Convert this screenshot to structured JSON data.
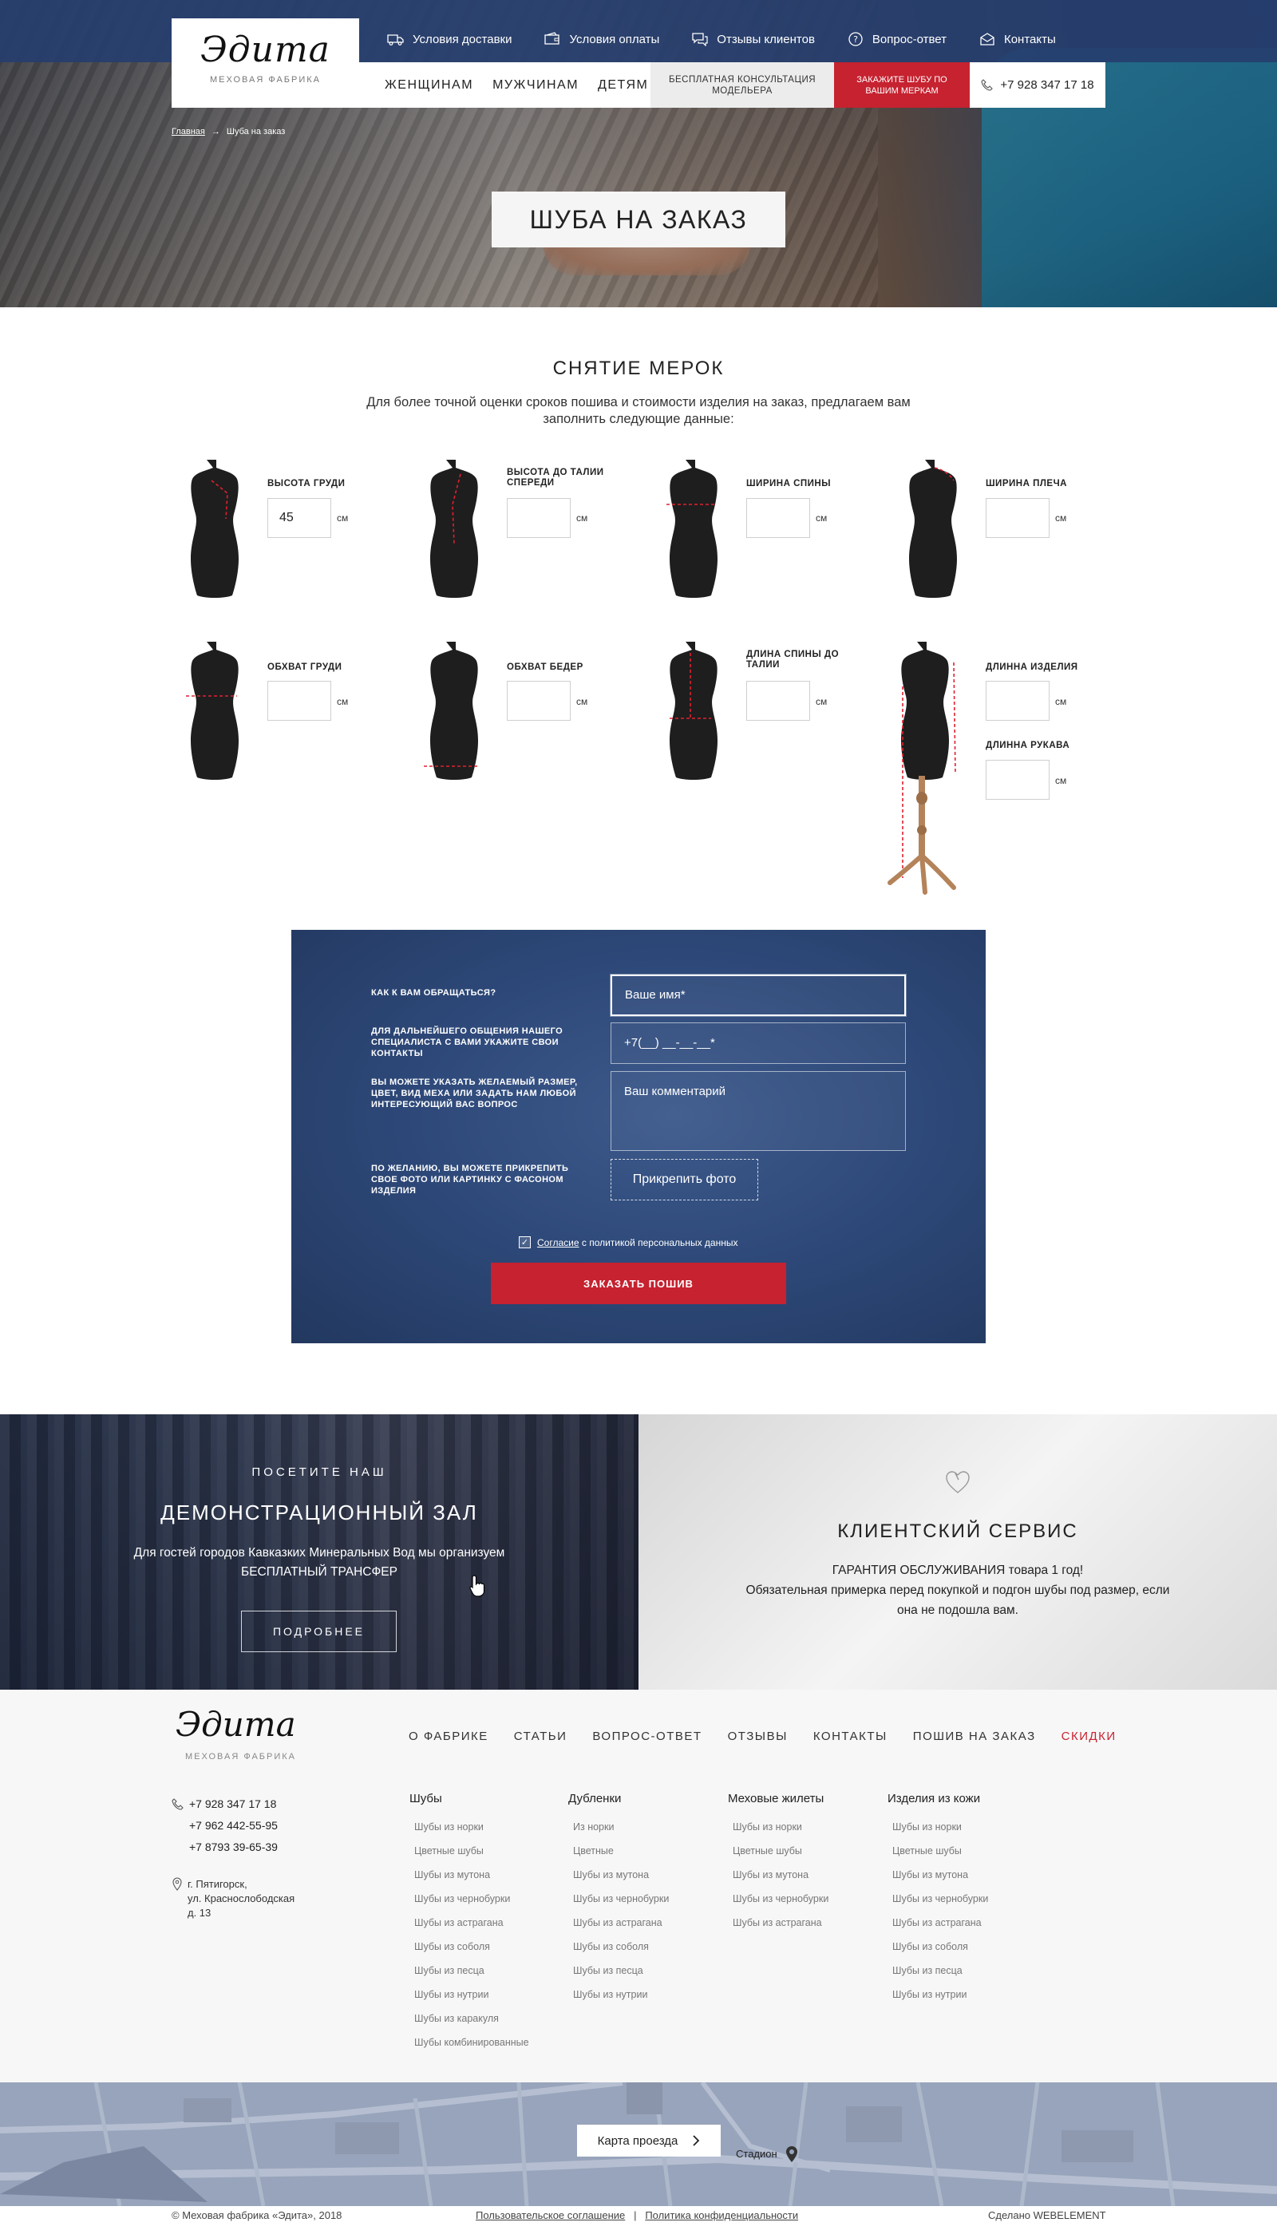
{
  "brand": {
    "name": "Эдита",
    "tagline": "МЕХОВАЯ ФАБРИКА"
  },
  "toplinks": [
    {
      "label": "Условия доставки",
      "icon": "truck-icon"
    },
    {
      "label": "Условия оплаты",
      "icon": "wallet-icon"
    },
    {
      "label": "Отзывы клиентов",
      "icon": "chat-icon"
    },
    {
      "label": "Вопрос-ответ",
      "icon": "question-icon"
    },
    {
      "label": "Контакты",
      "icon": "envelope-icon"
    }
  ],
  "nav": {
    "menu": [
      "ЖЕНЩИНАМ",
      "МУЖЧИНАМ",
      "ДЕТЯМ"
    ],
    "consult": "БЕСПЛАТНАЯ КОНСУЛЬТАЦИЯ МОДЕЛЬЕРА",
    "order": "ЗАКАЖИТЕ ШУБУ ПО ВАШИМ МЕРКАМ",
    "phone": "+7 928 347 17 18"
  },
  "breadcrumbs": {
    "home": "Главная",
    "sep": "→",
    "current": "Шуба на заказ"
  },
  "hero": {
    "title": "ШУБА НА ЗАКАЗ"
  },
  "measurements": {
    "title": "СНЯТИЕ МЕРОК",
    "description": "Для более точной оценки сроков пошива и стоимости изделия на заказ, предлагаем вам заполнить следующие данные:",
    "unit": "см",
    "items": [
      {
        "label": "ВЫСОТА ГРУДИ",
        "value": "45"
      },
      {
        "label": "ВЫСОТА ДО ТАЛИИ СПЕРЕДИ",
        "value": ""
      },
      {
        "label": "ШИРИНА СПИНЫ",
        "value": ""
      },
      {
        "label": "ШИРИНА ПЛЕЧА",
        "value": ""
      },
      {
        "label": "ОБХВАТ ГРУДИ",
        "value": ""
      },
      {
        "label": "ОБХВАТ БЕДЕР",
        "value": ""
      },
      {
        "label": "ДЛИНА СПИНЫ ДО ТАЛИИ",
        "value": ""
      },
      {
        "label": "ДЛИННА ИЗДЕЛИЯ",
        "value": ""
      },
      {
        "label": "ДЛИННА РУКАВА",
        "value": ""
      }
    ]
  },
  "form": {
    "name_label": "КАК К ВАМ ОБРАЩАТЬСЯ?",
    "name_placeholder": "Ваше имя*",
    "phone_label": "ДЛЯ ДАЛЬНЕЙШЕГО ОБЩЕНИЯ НАШЕГО СПЕЦИАЛИСТА С ВАМИ УКАЖИТЕ СВОИ КОНТАКТЫ",
    "phone_placeholder": "+7(__) __-__-__*",
    "comment_label": "ВЫ МОЖЕТЕ УКАЗАТЬ ЖЕЛАЕМЫЙ РАЗМЕР, ЦВЕТ, ВИД МЕХА ИЛИ ЗАДАТЬ НАМ ЛЮБОЙ ИНТЕРЕСУЮЩИЙ ВАС ВОПРОС",
    "comment_placeholder": "Ваш комментарий",
    "attach_label": "ПО ЖЕЛАНИЮ, ВЫ МОЖЕТЕ ПРИКРЕПИТЬ СВОЕ ФОТО ИЛИ КАРТИНКУ С ФАСОНОМ ИЗДЕЛИЯ",
    "attach_button": "Прикрепить фото",
    "consent_link": "Согласие",
    "consent_rest": "с политикой персональных данных",
    "submit": "ЗАКАЗАТЬ ПОШИВ"
  },
  "promo_left": {
    "kicker": "ПОСЕТИТЕ НАШ",
    "title": "ДЕМОНСТРАЦИОННЫЙ ЗАЛ",
    "desc1": "Для гостей городов Кавказких Минеральных Вод мы организуем",
    "desc2": "БЕСПЛАТНЫЙ ТРАНСФЕР",
    "button": "ПОДРОБНЕЕ"
  },
  "promo_right": {
    "title": "КЛИЕНТСКИЙ СЕРВИС",
    "line1a": "ГАРАНТИЯ ОБСЛУЖИВАНИЯ",
    "line1b": "товара  1 год!",
    "line2": "Обязательная примерка перед покупкой и подгон шубы под размер, если она не подошла вам."
  },
  "footer": {
    "nav": [
      "О ФАБРИКЕ",
      "СТАТЬИ",
      "ВОПРОС-ОТВЕТ",
      "ОТЗЫВЫ",
      "КОНТАКТЫ",
      "ПОШИВ НА ЗАКАЗ",
      "СКИДКИ"
    ],
    "phones": [
      "+7 928 347 17 18",
      "+7 962 442-55-95",
      "+7 8793 39-65-39"
    ],
    "address": [
      "г. Пятигорск,",
      "ул. Краснослободская",
      "д. 13"
    ],
    "columns": [
      {
        "title": "Шубы",
        "items": [
          "Шубы из норки",
          "Цветные шубы",
          "Шубы из мутона",
          "Шубы из чернобурки",
          "Шубы из астрагана",
          "Шубы из соболя",
          "Шубы из песца",
          "Шубы из нутрии",
          "Шубы из каракуля",
          "Шубы комбинированные"
        ]
      },
      {
        "title": "Дубленки",
        "items": [
          "Из норки",
          "Цветные",
          "Шубы из мутона",
          "Шубы из чернобурки",
          "Шубы из астрагана",
          "Шубы из соболя",
          "Шубы из песца",
          "Шубы из нутрии"
        ]
      },
      {
        "title": "Меховые жилеты",
        "items": [
          "Шубы из норки",
          "Цветные шубы",
          "Шубы из мутона",
          "Шубы из чернобурки",
          "Шубы из астрагана"
        ]
      },
      {
        "title": "Изделия из кожи",
        "items": [
          "Шубы из норки",
          "Цветные шубы",
          "Шубы из мутона",
          "Шубы из чернобурки",
          "Шубы из астрагана",
          "Шубы из соболя",
          "Шубы из песца",
          "Шубы из нутрии"
        ]
      }
    ],
    "map_button": "Карта проезда",
    "map_label": "Стадион",
    "copyright": "© Меховая фабрика «Эдита», 2018",
    "terms": "Пользовательское соглашение",
    "privacy": "Политика конфиденциальности",
    "made_by": "Сделано WEBELEMENT"
  },
  "colors": {
    "navy": "#263e6e",
    "red": "#c62230",
    "form_bg": "#2d4878"
  }
}
